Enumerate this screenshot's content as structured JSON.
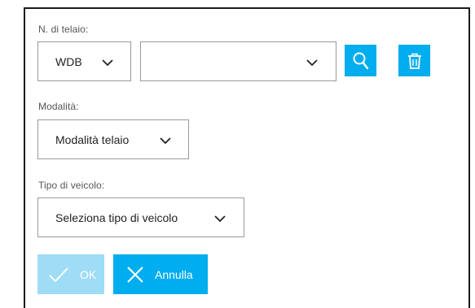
{
  "form": {
    "vin": {
      "label": "N. di telaio:",
      "prefix_value": "WDB",
      "number_value": ""
    },
    "mode": {
      "label": "Modalità:",
      "value": "Modalità telaio"
    },
    "vehicle_type": {
      "label": "Tipo di veicolo:",
      "value": "Seleziona tipo di veicolo"
    }
  },
  "actions": {
    "ok_label": "OK",
    "cancel_label": "Annulla"
  },
  "icons": {
    "search": "search-icon",
    "delete": "trash-icon",
    "chevron": "chevron-down-icon",
    "check": "check-icon",
    "close": "close-icon"
  },
  "colors": {
    "accent": "#00adef",
    "accent_disabled": "#9fdcf6",
    "border": "#9a9a9a"
  }
}
